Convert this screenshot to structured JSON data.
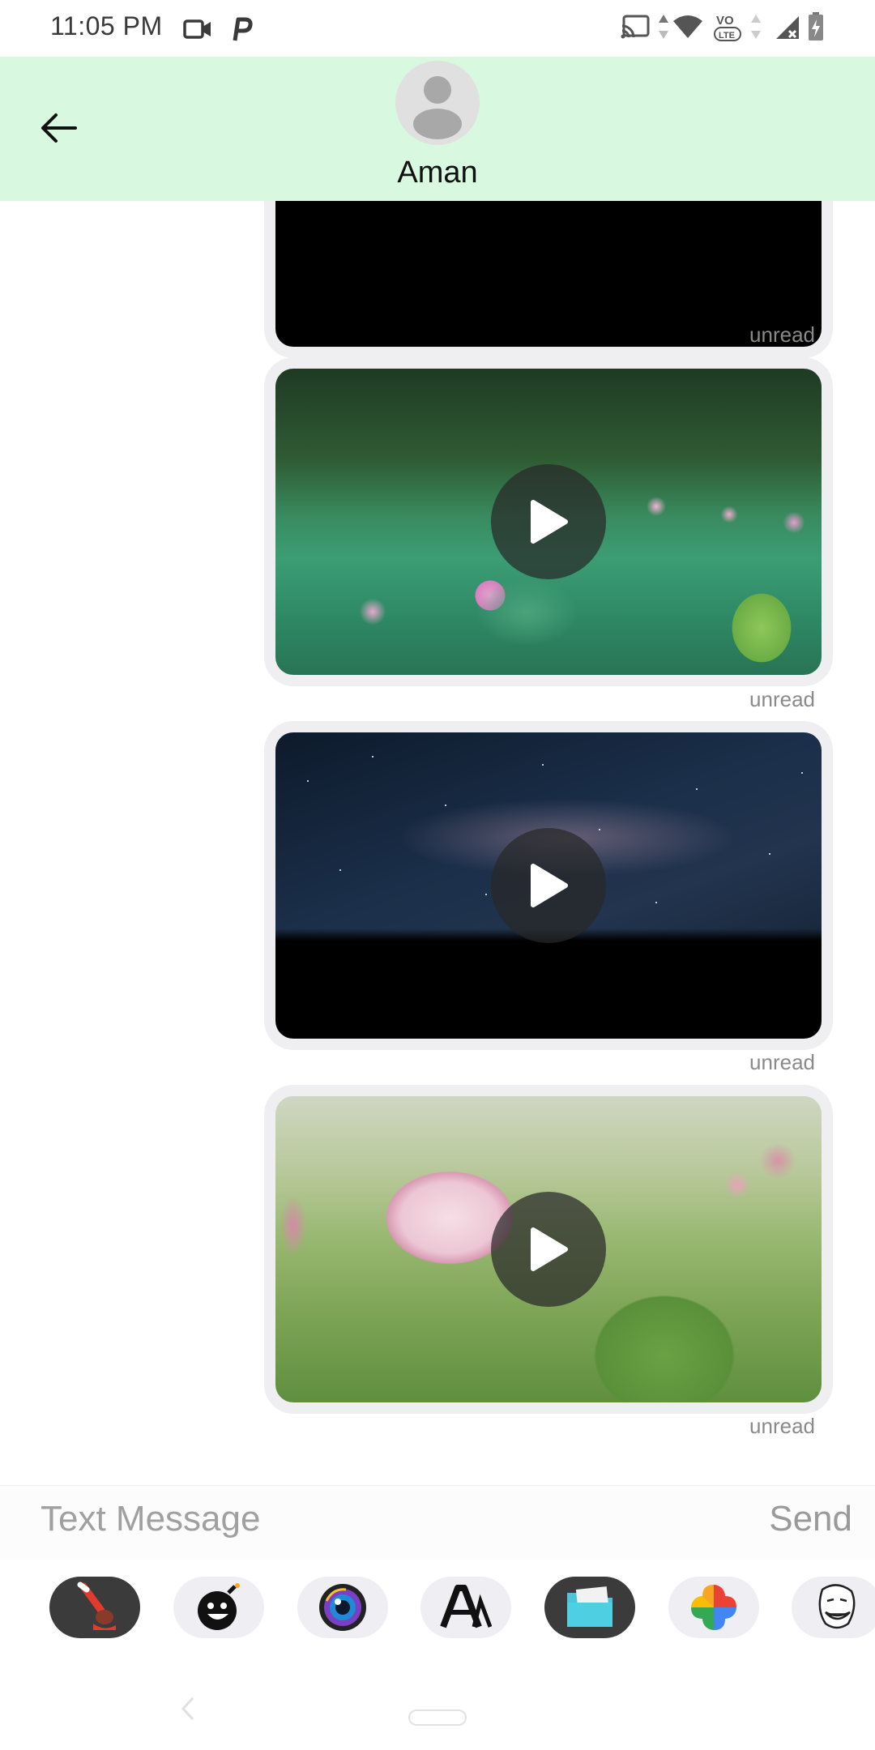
{
  "status_bar": {
    "time": "11:05 PM",
    "left_icons": [
      "video-camera-icon",
      "p-app-icon"
    ],
    "right_icons": [
      "cast-icon",
      "data-arrows-icon",
      "wifi-icon",
      "volte-icon",
      "signal-icon",
      "battery-icon"
    ],
    "volte_label": "VO",
    "lte_label": "LTE"
  },
  "header": {
    "back_icon": "arrow-left-icon",
    "avatar_icon": "person-avatar-icon",
    "contact_name": "Aman",
    "background": "#d8f8df"
  },
  "messages": [
    {
      "kind": "video",
      "thumbnail": "black",
      "status": "unread",
      "partially_visible": true
    },
    {
      "kind": "video",
      "thumbnail": "lotus-field",
      "status": "unread"
    },
    {
      "kind": "video",
      "thumbnail": "milky-way",
      "status": "unread"
    },
    {
      "kind": "video",
      "thumbnail": "lotus-closeup",
      "status": "unread"
    }
  ],
  "compose": {
    "placeholder": "Text Message",
    "send_label": "Send"
  },
  "apps": [
    {
      "name": "paint-brush-app-icon"
    },
    {
      "name": "bomb-sticker-app-icon"
    },
    {
      "name": "camera-lens-app-icon"
    },
    {
      "name": "text-style-app-icon",
      "glyph": "A"
    },
    {
      "name": "files-folder-app-icon"
    },
    {
      "name": "google-photos-app-icon"
    },
    {
      "name": "meme-face-app-icon"
    }
  ]
}
